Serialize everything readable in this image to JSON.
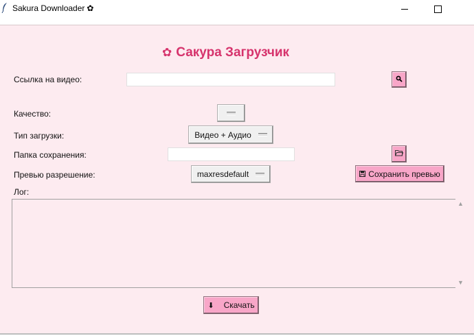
{
  "window": {
    "title": "Sakura Downloader",
    "title_icon": "✿",
    "app_icon": "feather-icon",
    "minimize_glyph": "minimize-icon",
    "maximize_glyph": "maximize-icon"
  },
  "header": {
    "icon": "✿",
    "title": "Сакура Загрузчик",
    "accent_color": "#d6336c"
  },
  "form": {
    "url_label": "Ссылка на видео:",
    "url_value": "",
    "search_button_icon": "🔍",
    "quality_label": "Качество:",
    "quality_value": "",
    "download_type_label": "Тип загрузки:",
    "download_type_value": "Видео + Аудио",
    "folder_label": "Папка сохранения:",
    "folder_value": "",
    "folder_button_icon": "🗁",
    "preview_label": "Превью разрешение:",
    "preview_value": "maxresdefault",
    "save_preview_icon": "💾",
    "save_preview_label": "Сохранить превью"
  },
  "log": {
    "label": "Лог:",
    "content": ""
  },
  "download": {
    "icon": "⬇",
    "label": "Скачать"
  },
  "colors": {
    "background": "#fdebf0",
    "button_pink": "#f8a6c8"
  }
}
